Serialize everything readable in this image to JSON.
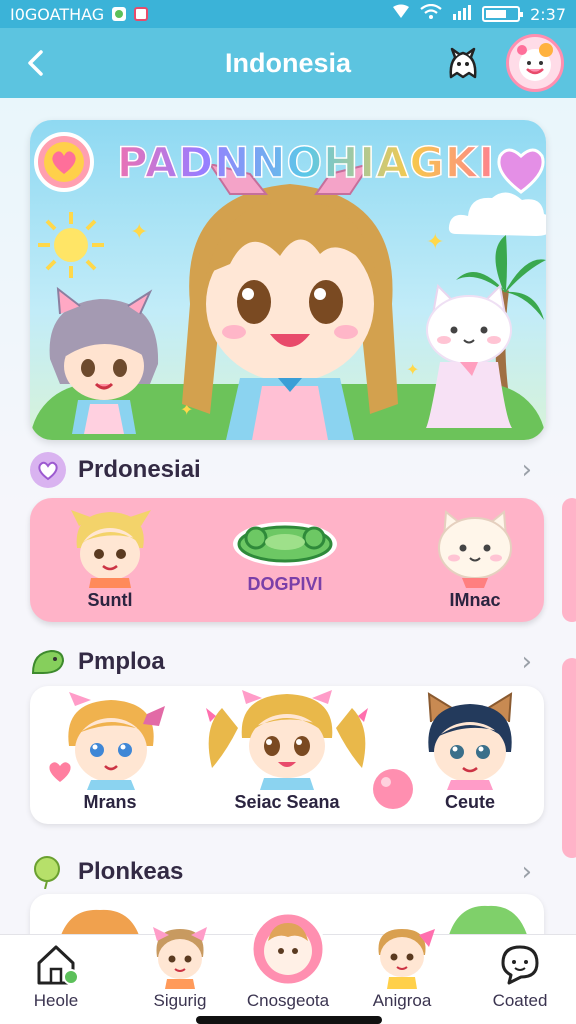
{
  "status_bar": {
    "left_text": "I0GOATHAG",
    "time": "2:37"
  },
  "header": {
    "title": "Indonesia"
  },
  "banner": {
    "title": "PADNNOHIAGKI"
  },
  "sections": [
    {
      "title": "Prdonesiai",
      "items": [
        {
          "label": "Suntl"
        },
        {
          "label": "DOGPIVI"
        },
        {
          "label": "IMnac"
        }
      ]
    },
    {
      "title": "Pmploa",
      "items": [
        {
          "label": "Mrans"
        },
        {
          "label": "Seiac Seana"
        },
        {
          "label": "Ceute"
        }
      ]
    },
    {
      "title": "Plonkeas",
      "items": []
    }
  ],
  "bottom_nav": [
    {
      "label": "Heole",
      "icon": "home-icon"
    },
    {
      "label": "Sigurig",
      "icon": "character-icon"
    },
    {
      "label": "Cnosgeota",
      "icon": "center-character-icon"
    },
    {
      "label": "Anigroa",
      "icon": "character-icon"
    },
    {
      "label": "Coated",
      "icon": "chat-icon"
    }
  ],
  "colors": {
    "header": "#5cc4e0",
    "status": "#3bb3d8",
    "card_pink": "#ffb3c8"
  }
}
